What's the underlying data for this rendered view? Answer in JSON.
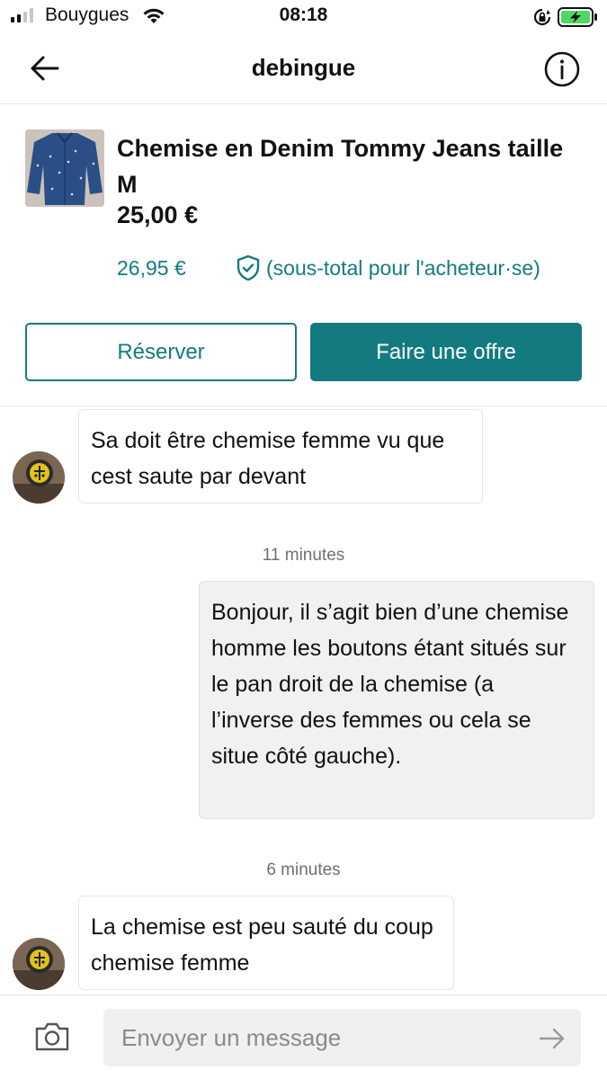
{
  "status_bar": {
    "carrier": "Bouygues",
    "time": "08:18",
    "icons": [
      "signal-icon",
      "wifi-icon",
      "orientation-lock-icon",
      "battery-charging-icon"
    ],
    "battery_color": "#4cd964"
  },
  "header": {
    "title": "debingue",
    "icons": [
      "back-arrow-icon",
      "info-icon"
    ]
  },
  "product": {
    "title": "Chemise en Denim Tommy Jeans taille M",
    "price": "25,00 €",
    "buyer_price": "26,95 €",
    "buyer_note": "(sous-total pour l'acheteur·se)",
    "reserve_label": "Réserver",
    "offer_label": "Faire une offre"
  },
  "conversation": {
    "messages": [
      {
        "from": "other",
        "text": "Sa doit être chemise femme vu que cest saute par devant"
      },
      {
        "timestamp": "11 minutes"
      },
      {
        "from": "me",
        "text": "Bonjour, il s’agit bien d’une chemise homme les boutons étant situés sur le pan droit de la chemise (a l’inverse des femmes ou cela se situe côté gauche)."
      },
      {
        "timestamp": "6 minutes"
      },
      {
        "from": "other",
        "text": "La chemise est peu sauté du coup chemise femme"
      }
    ]
  },
  "composer": {
    "placeholder": "Envoyer un message",
    "icons": [
      "camera-icon",
      "send-arrow-icon"
    ]
  },
  "colors": {
    "accent": "#137b80",
    "outgoing_bubble": "#f1f1f1",
    "divider": "#e6e6e6"
  }
}
